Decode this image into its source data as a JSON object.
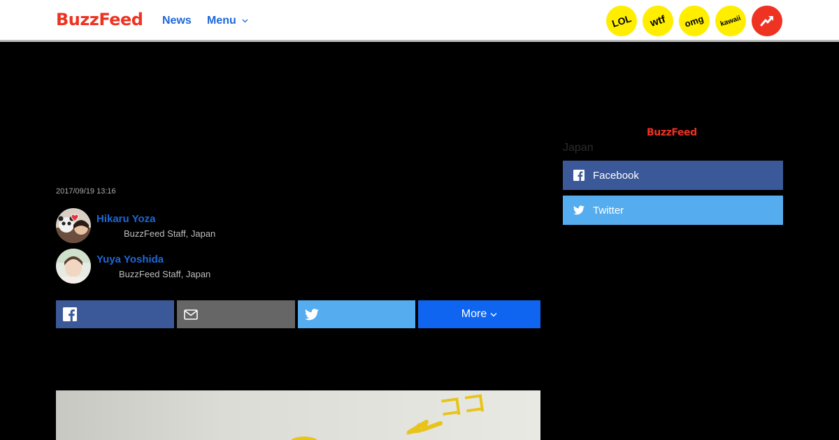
{
  "header": {
    "logo": "BuzzFeed",
    "nav": {
      "news": "News",
      "menu": "Menu"
    },
    "badges": [
      "LOL",
      "wtf",
      "omg",
      "kawaii"
    ],
    "trending_icon": "trending-arrow-icon"
  },
  "article": {
    "timestamp": "2017/09/19 13:16",
    "authors": [
      {
        "name": "Hikaru Yoza",
        "role": "BuzzFeed Staff, Japan"
      },
      {
        "name": "Yuya Yoshida",
        "role": "BuzzFeed Staff, Japan"
      }
    ],
    "share": {
      "facebook_icon": "facebook-icon",
      "email_icon": "mail-icon",
      "twitter_icon": "twitter-icon",
      "more_label": "More"
    },
    "image_annotation": "ココ"
  },
  "sidebar": {
    "logo": "BuzzFeed",
    "edition": "Japan",
    "facebook_label": "Facebook",
    "twitter_label": "Twitter"
  },
  "colors": {
    "brand_red": "#ee3322",
    "link_blue": "#1d67d9",
    "badge_yellow": "#ffee00",
    "facebook_blue": "#3b5998",
    "twitter_blue": "#55acee",
    "email_gray": "#666666",
    "more_blue": "#0f65ef"
  }
}
